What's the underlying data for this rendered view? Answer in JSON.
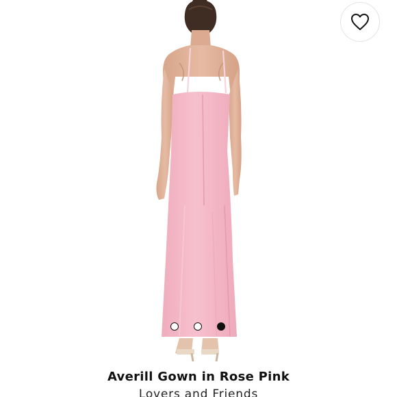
{
  "product": {
    "title": "Averill Gown in Rose Pink",
    "brand": "Lovers and Friends",
    "image": {
      "subject": "gown-back-view-image",
      "colors": {
        "gown": "#f6bccb",
        "skin": "#e0b299",
        "hair": "#3b2a20",
        "shoe": "#e9d8c6"
      }
    }
  },
  "wishlist": {
    "icon": "heart-outline-icon",
    "saved": false
  },
  "carousel": {
    "count": 3,
    "active_index": 2
  }
}
